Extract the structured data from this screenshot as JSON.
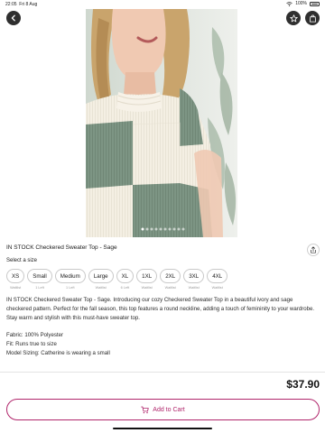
{
  "status_bar": {
    "time": "22:05",
    "date": "Fri 8 Aug",
    "battery": "100%"
  },
  "product": {
    "title": "IN STOCK Checkered Sweater Top - Sage",
    "price": "$37.90",
    "image_count": 11,
    "active_image_index": 0
  },
  "size_section": {
    "label": "Select a size",
    "options": [
      {
        "label": "XS",
        "note": "Waitlist"
      },
      {
        "label": "Small",
        "note": "1 Left"
      },
      {
        "label": "Medium",
        "note": "1 Left"
      },
      {
        "label": "Large",
        "note": "Waitlist"
      },
      {
        "label": "XL",
        "note": "6 Left"
      },
      {
        "label": "1XL",
        "note": "Waitlist"
      },
      {
        "label": "2XL",
        "note": "Waitlist"
      },
      {
        "label": "3XL",
        "note": "Waitlist"
      },
      {
        "label": "4XL",
        "note": "Waitlist"
      }
    ]
  },
  "description": {
    "paragraph": "IN STOCK Checkered Sweater Top - Sage. Introducing our cozy Checkered Sweater Top in a beautiful ivory and sage checkered pattern. Perfect for the fall season, this top features a round neckline, adding a touch of femininity to your wardrobe. Stay warm and stylish with this must-have sweater top.",
    "fabric": "Fabric: 100% Polyester",
    "fit": "Fit: Runs true to size",
    "model_sizing": "Model Sizing: Catherine is wearing a small"
  },
  "cart": {
    "button_label": "Add to Cart"
  },
  "colors": {
    "accent": "#b0256b",
    "sage": "#7d9584",
    "ivory": "#f4efe3"
  },
  "icons": {
    "back": "chevron-left-icon",
    "favorite": "star-icon",
    "cart": "shopping-bag-icon",
    "share": "share-icon",
    "add_to_cart": "cart-icon"
  }
}
